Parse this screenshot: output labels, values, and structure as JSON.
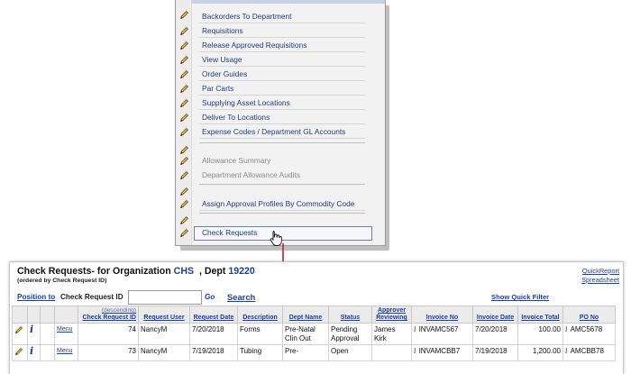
{
  "menu": {
    "items": [
      {
        "label": "Backorders To Department",
        "disabled": false
      },
      {
        "label": "Requisitions",
        "disabled": false
      },
      {
        "label": "Release Approved Requisitions",
        "disabled": false
      },
      {
        "label": "View Usage",
        "disabled": false
      },
      {
        "label": "Order Guides",
        "disabled": false
      },
      {
        "label": "Par Carts",
        "disabled": false
      },
      {
        "label": "Supplying Asset Locations",
        "disabled": false
      },
      {
        "label": "Deliver To Locations",
        "disabled": false
      },
      {
        "label": "Expense Codes / Department GL Accounts",
        "disabled": false
      },
      {
        "label": "Allowance Summary",
        "disabled": true
      },
      {
        "label": "Department Allowance Audits",
        "disabled": true
      },
      {
        "label": "Assign Approval Profiles By Commodity Code",
        "disabled": false
      },
      {
        "label": "Check Requests",
        "disabled": false,
        "hovered": true
      }
    ]
  },
  "panel": {
    "title_prefix": "Check Requests- for Organization",
    "org": "CHS",
    "dept_label": ", Dept",
    "dept": "19220",
    "subtitle": "(ordered by Check Request ID)",
    "quick_report": "QuickReport",
    "spreadsheet": "Spreadsheet",
    "position_link": "Position to",
    "position_label": "Check Request ID",
    "go": "Go",
    "search": "Search",
    "show_filter": "Show Quick Filter"
  },
  "table": {
    "sort_note": "(descending)",
    "headers": {
      "check_request_id": "Check Request ID",
      "request_user": "Request User",
      "request_date": "Request Date",
      "description": "Description",
      "dept_name": "Dept Name",
      "status": "Status",
      "approver": "Approver Reviewing",
      "invoice_no": "Invoice No",
      "invoice_date": "Invoice Date",
      "invoice_total": "Invoice Total",
      "po_no": "PO No"
    },
    "rows": [
      {
        "menu": "Menu",
        "id": "74",
        "user": "NancyM",
        "date": "7/20/2018",
        "description": "Forms",
        "dept_name": "Pre-Natal Clin Out",
        "status": "Pending Approval",
        "approver": "James Kirk",
        "invoice_no": "INVAMC567",
        "invoice_date": "7/20/2018",
        "invoice_total": "100.00",
        "po_no": "AMC5678"
      },
      {
        "menu": "Menu",
        "id": "73",
        "user": "NancyM",
        "date": "7/19/2018",
        "description": "Tubing",
        "dept_name": "Pre-",
        "status": "Open",
        "approver": "",
        "invoice_no": "INVAMCBB7",
        "invoice_date": "7/19/2018",
        "invoice_total": "1,200.00",
        "po_no": "AMCBB78"
      }
    ]
  },
  "colors": {
    "link": "#1a3fa6",
    "arrow": "#cc1f1f",
    "header_bg": "#ebebeb"
  }
}
